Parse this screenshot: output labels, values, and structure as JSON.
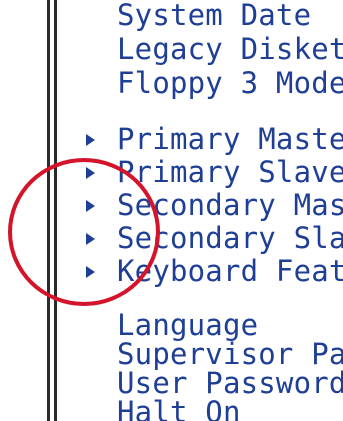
{
  "menu": {
    "items": [
      {
        "label": "System Date",
        "submenu": false
      },
      {
        "label": "Legacy Diskett",
        "submenu": false
      },
      {
        "label": "Floppy 3 Mode",
        "submenu": false
      },
      {
        "label": "Primary Master",
        "submenu": true
      },
      {
        "label": "Primary Slave",
        "submenu": true
      },
      {
        "label": "Secondary Mast",
        "submenu": true
      },
      {
        "label": "Secondary Slav",
        "submenu": true
      },
      {
        "label": "Keyboard Featu",
        "submenu": true
      },
      {
        "label": "Language",
        "submenu": false
      },
      {
        "label": "Supervisor Pas",
        "submenu": false
      },
      {
        "label": "User Password",
        "submenu": false
      },
      {
        "label": "Halt On",
        "submenu": false
      }
    ]
  },
  "colors": {
    "text": "#1f3e96",
    "frame": "#2b2b2b",
    "background": "#ffffff",
    "highlight": "#d3142a"
  },
  "annotation": {
    "shape": "circle",
    "color": "#d3142a"
  }
}
